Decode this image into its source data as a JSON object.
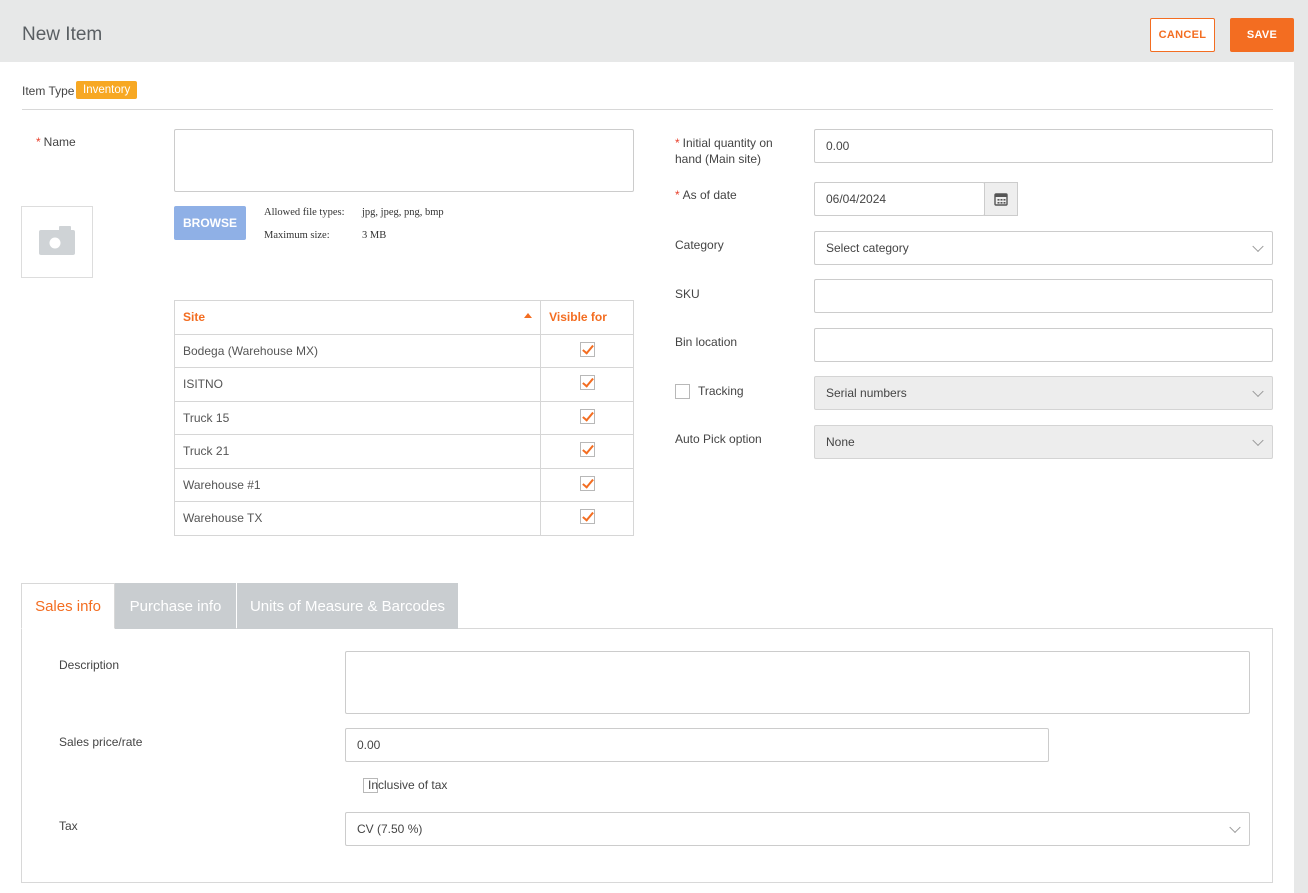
{
  "header": {
    "title": "New Item",
    "cancel_label": "CANCEL",
    "save_label": "SAVE"
  },
  "item_type": {
    "label": "Item Type",
    "value": "Inventory"
  },
  "name_field": {
    "label": "Name",
    "required_mark": "*",
    "value": ""
  },
  "image_upload": {
    "browse_label": "BROWSE",
    "allowed_types_label": "Allowed file types:",
    "allowed_types_value": "jpg, jpeg, png, bmp",
    "max_size_label": "Maximum size:",
    "max_size_value": "3 MB"
  },
  "sites_table": {
    "columns": [
      "Site",
      "Visible for"
    ],
    "rows": [
      {
        "site": "Bodega (Warehouse MX)",
        "visible": true
      },
      {
        "site": "ISITNO",
        "visible": true
      },
      {
        "site": "Truck 15",
        "visible": true
      },
      {
        "site": "Truck 21",
        "visible": true
      },
      {
        "site": "Warehouse #1",
        "visible": true
      },
      {
        "site": "Warehouse TX",
        "visible": true
      }
    ]
  },
  "right_form": {
    "initial_qty_label_1": "Initial quantity on",
    "initial_qty_label_2": "hand (Main site)",
    "initial_qty_value": "0.00",
    "as_of_date_label": "As of date",
    "as_of_date_value": "06/04/2024",
    "category_label": "Category",
    "category_value": "Select category",
    "sku_label": "SKU",
    "sku_value": "",
    "bin_location_label": "Bin location",
    "bin_location_value": "",
    "tracking_label": "Tracking",
    "tracking_checked": false,
    "tracking_value": "Serial numbers",
    "auto_pick_label": "Auto Pick option",
    "auto_pick_value": "None"
  },
  "tabs": [
    {
      "label": "Sales info",
      "active": true
    },
    {
      "label": "Purchase info",
      "active": false
    },
    {
      "label": "Units of Measure & Barcodes",
      "active": false
    }
  ],
  "sales_info": {
    "description_label": "Description",
    "description_value": "",
    "price_label": "Sales price/rate",
    "price_value": "0.00",
    "inclusive_tax_label": "Inclusive of tax",
    "inclusive_tax_checked": false,
    "tax_label": "Tax",
    "tax_value": "CV (7.50 %)"
  },
  "colors": {
    "accent": "#f36d21",
    "badge": "#f7a823",
    "browse": "#8fb0e6",
    "tab_inactive": "#c9cdd0"
  }
}
